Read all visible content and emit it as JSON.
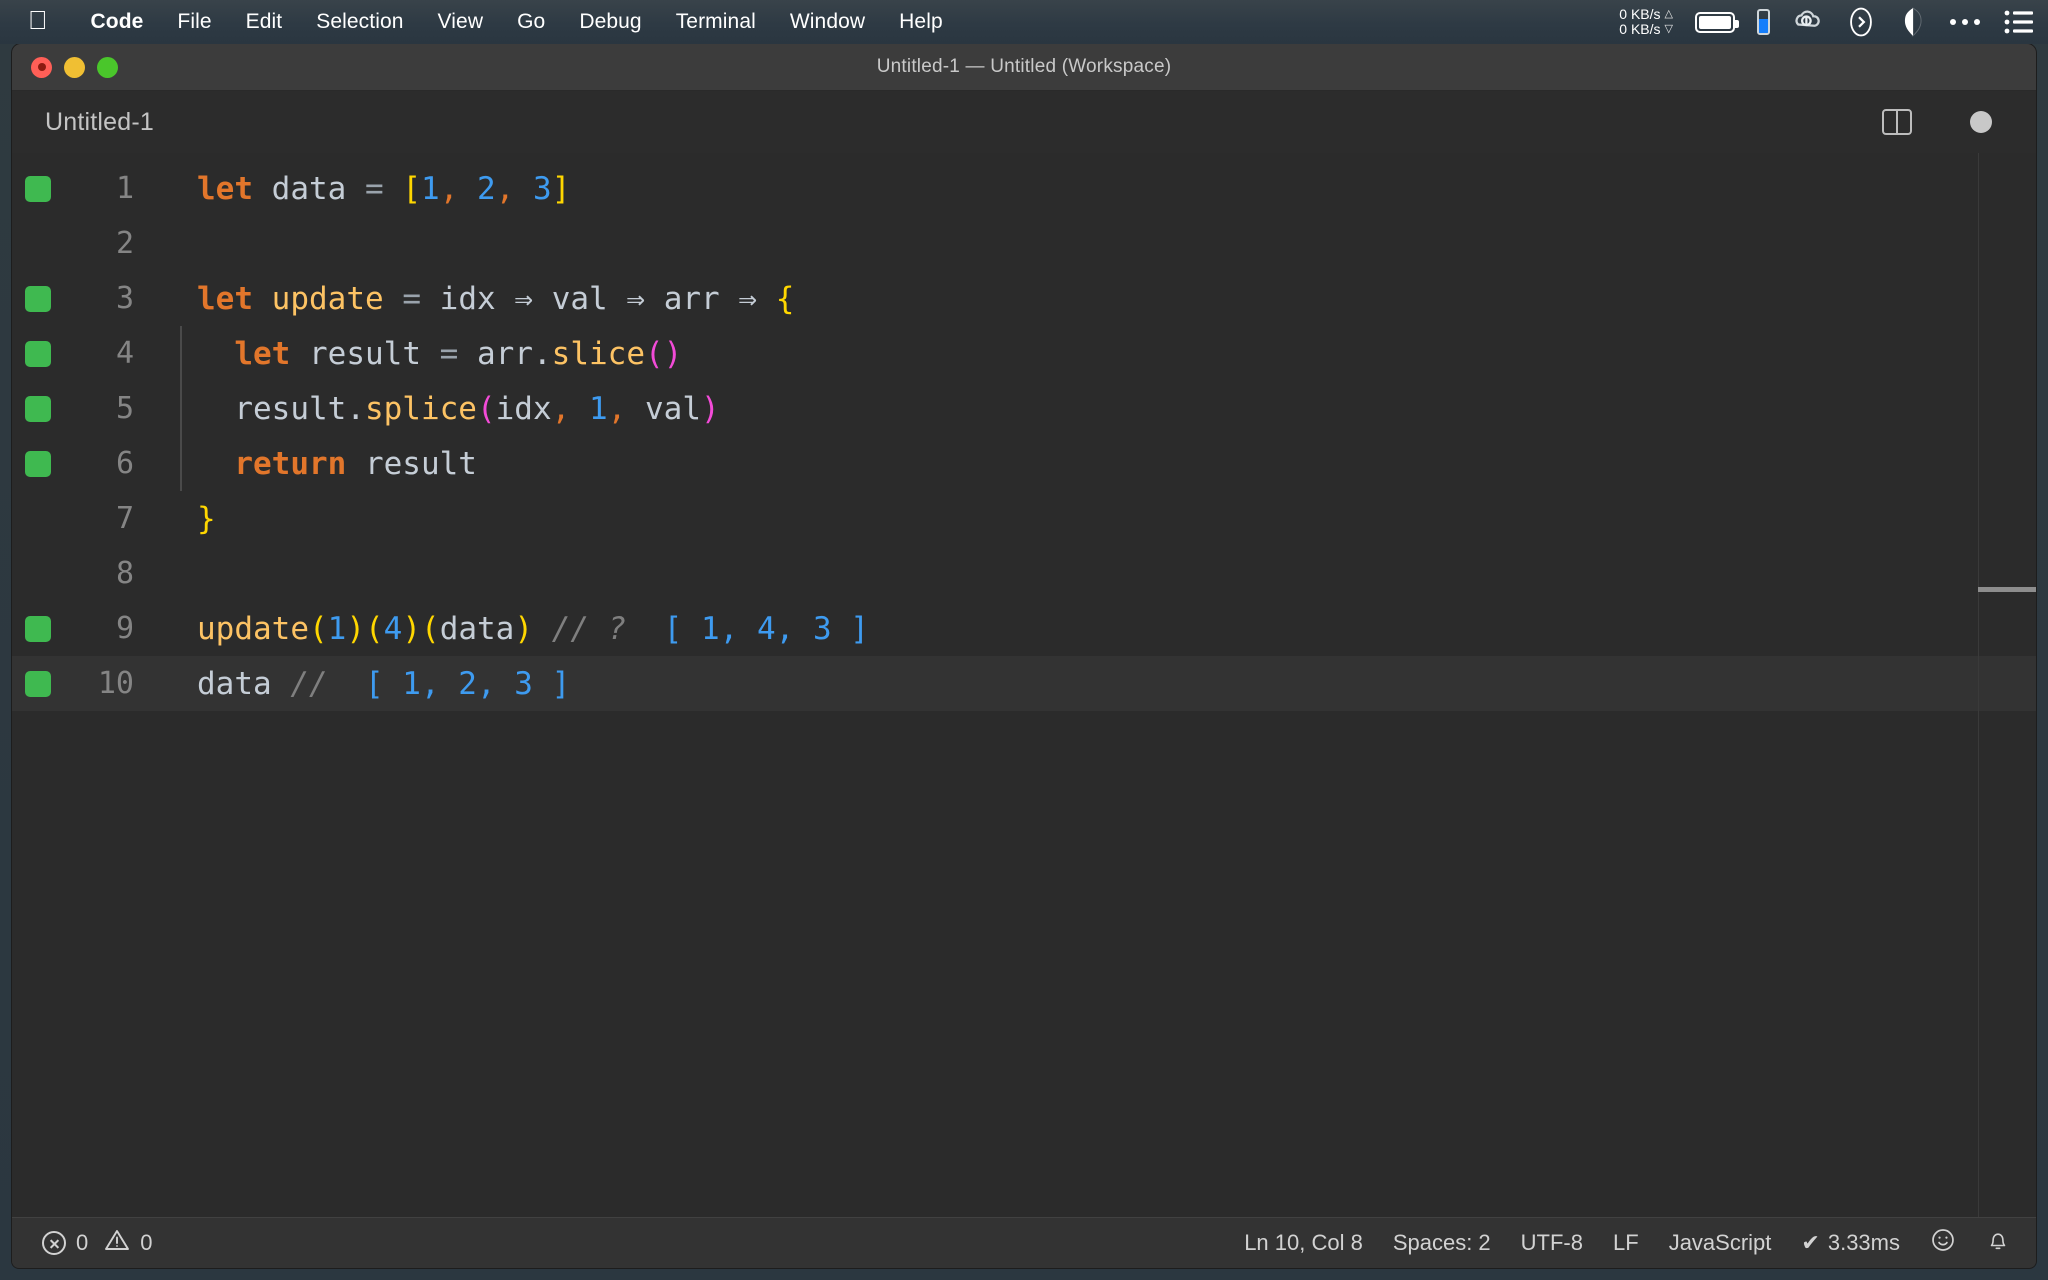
{
  "menubar": {
    "apple_icon": "apple-logo",
    "items": [
      {
        "label": "Code",
        "bold": true
      },
      {
        "label": "File",
        "bold": false
      },
      {
        "label": "Edit",
        "bold": false
      },
      {
        "label": "Selection",
        "bold": false
      },
      {
        "label": "View",
        "bold": false
      },
      {
        "label": "Go",
        "bold": false
      },
      {
        "label": "Debug",
        "bold": false
      },
      {
        "label": "Terminal",
        "bold": false
      },
      {
        "label": "Window",
        "bold": false
      },
      {
        "label": "Help",
        "bold": false
      }
    ],
    "net_up": "0 KB/s",
    "net_down": "0 KB/s",
    "up_arrow": "△",
    "down_arrow": "▽",
    "status_icons": [
      "battery-icon",
      "phone-battery-icon",
      "cloud-sync-icon",
      "chevron-circle-icon",
      "shield-icon",
      "ellipsis-icon",
      "list-menu-icon"
    ]
  },
  "window": {
    "title": "Untitled-1 — Untitled (Workspace)",
    "traffic_lights": [
      "close",
      "minimize",
      "zoom"
    ]
  },
  "tabbar": {
    "tabs": [
      {
        "label": "Untitled-1",
        "active": true,
        "dirty": true
      }
    ],
    "split_editor_icon": "split-editor-icon",
    "unsaved_indicator": "unsaved-dot-icon"
  },
  "editor": {
    "language": "JavaScript",
    "current_line": 10,
    "lines": [
      {
        "number": "1",
        "marker": "green",
        "current": false,
        "indent_guide": false,
        "tokens": [
          {
            "t": "let",
            "c": "t-key"
          },
          {
            "t": " ",
            "c": "t-plain"
          },
          {
            "t": "data",
            "c": "t-plain"
          },
          {
            "t": " ",
            "c": "t-plain"
          },
          {
            "t": "=",
            "c": "t-op"
          },
          {
            "t": " ",
            "c": "t-plain"
          },
          {
            "t": "[",
            "c": "t-br1"
          },
          {
            "t": "1",
            "c": "t-num"
          },
          {
            "t": ",",
            "c": "t-comma"
          },
          {
            "t": " ",
            "c": "t-plain"
          },
          {
            "t": "2",
            "c": "t-num"
          },
          {
            "t": ",",
            "c": "t-comma"
          },
          {
            "t": " ",
            "c": "t-plain"
          },
          {
            "t": "3",
            "c": "t-num"
          },
          {
            "t": "]",
            "c": "t-br1"
          }
        ]
      },
      {
        "number": "2",
        "marker": "none",
        "current": false,
        "indent_guide": false,
        "tokens": []
      },
      {
        "number": "3",
        "marker": "green",
        "current": false,
        "indent_guide": false,
        "tokens": [
          {
            "t": "let",
            "c": "t-key"
          },
          {
            "t": " ",
            "c": "t-plain"
          },
          {
            "t": "update",
            "c": "t-fn"
          },
          {
            "t": " ",
            "c": "t-plain"
          },
          {
            "t": "=",
            "c": "t-op"
          },
          {
            "t": " ",
            "c": "t-plain"
          },
          {
            "t": "idx",
            "c": "t-plain"
          },
          {
            "t": " ",
            "c": "t-plain"
          },
          {
            "t": "⇒",
            "c": "t-arrow"
          },
          {
            "t": " ",
            "c": "t-plain"
          },
          {
            "t": "val",
            "c": "t-plain"
          },
          {
            "t": " ",
            "c": "t-plain"
          },
          {
            "t": "⇒",
            "c": "t-arrow"
          },
          {
            "t": " ",
            "c": "t-plain"
          },
          {
            "t": "arr",
            "c": "t-plain"
          },
          {
            "t": " ",
            "c": "t-plain"
          },
          {
            "t": "⇒",
            "c": "t-arrow"
          },
          {
            "t": " ",
            "c": "t-plain"
          },
          {
            "t": "{",
            "c": "t-br1"
          }
        ]
      },
      {
        "number": "4",
        "marker": "green",
        "current": false,
        "indent_guide": true,
        "tokens": [
          {
            "t": "  ",
            "c": "t-plain"
          },
          {
            "t": "let",
            "c": "t-key"
          },
          {
            "t": " ",
            "c": "t-plain"
          },
          {
            "t": "result",
            "c": "t-plain"
          },
          {
            "t": " ",
            "c": "t-plain"
          },
          {
            "t": "=",
            "c": "t-op"
          },
          {
            "t": " ",
            "c": "t-plain"
          },
          {
            "t": "arr",
            "c": "t-plain"
          },
          {
            "t": ".",
            "c": "t-plain"
          },
          {
            "t": "slice",
            "c": "t-fn"
          },
          {
            "t": "(",
            "c": "t-br2"
          },
          {
            "t": ")",
            "c": "t-br2"
          }
        ]
      },
      {
        "number": "5",
        "marker": "green",
        "current": false,
        "indent_guide": true,
        "tokens": [
          {
            "t": "  ",
            "c": "t-plain"
          },
          {
            "t": "result",
            "c": "t-plain"
          },
          {
            "t": ".",
            "c": "t-plain"
          },
          {
            "t": "splice",
            "c": "t-fn"
          },
          {
            "t": "(",
            "c": "t-br2"
          },
          {
            "t": "idx",
            "c": "t-plain"
          },
          {
            "t": ",",
            "c": "t-comma"
          },
          {
            "t": " ",
            "c": "t-plain"
          },
          {
            "t": "1",
            "c": "t-num"
          },
          {
            "t": ",",
            "c": "t-comma"
          },
          {
            "t": " ",
            "c": "t-plain"
          },
          {
            "t": "val",
            "c": "t-plain"
          },
          {
            "t": ")",
            "c": "t-br2"
          }
        ]
      },
      {
        "number": "6",
        "marker": "green",
        "current": false,
        "indent_guide": true,
        "tokens": [
          {
            "t": "  ",
            "c": "t-plain"
          },
          {
            "t": "return",
            "c": "t-key"
          },
          {
            "t": " ",
            "c": "t-plain"
          },
          {
            "t": "result",
            "c": "t-plain"
          }
        ]
      },
      {
        "number": "7",
        "marker": "none",
        "current": false,
        "indent_guide": false,
        "tokens": [
          {
            "t": "}",
            "c": "t-br1"
          }
        ]
      },
      {
        "number": "8",
        "marker": "none",
        "current": false,
        "indent_guide": false,
        "tokens": []
      },
      {
        "number": "9",
        "marker": "green",
        "current": false,
        "indent_guide": false,
        "tokens": [
          {
            "t": "update",
            "c": "t-fn"
          },
          {
            "t": "(",
            "c": "t-br1"
          },
          {
            "t": "1",
            "c": "t-num"
          },
          {
            "t": ")",
            "c": "t-br1"
          },
          {
            "t": "(",
            "c": "t-br1"
          },
          {
            "t": "4",
            "c": "t-num"
          },
          {
            "t": ")",
            "c": "t-br1"
          },
          {
            "t": "(",
            "c": "t-br1"
          },
          {
            "t": "data",
            "c": "t-plain"
          },
          {
            "t": ")",
            "c": "t-br1"
          },
          {
            "t": " ",
            "c": "t-plain"
          },
          {
            "t": "// ?",
            "c": "t-comment"
          },
          {
            "t": "  ",
            "c": "t-plain"
          },
          {
            "t": "[ 1, 4, 3 ]",
            "c": "t-cmt-val"
          }
        ]
      },
      {
        "number": "10",
        "marker": "green",
        "current": true,
        "indent_guide": false,
        "tokens": [
          {
            "t": "data",
            "c": "t-plain"
          },
          {
            "t": " ",
            "c": "t-plain"
          },
          {
            "t": "//",
            "c": "t-comment"
          },
          {
            "t": "  ",
            "c": "t-plain"
          },
          {
            "t": "[ 1, 2, 3 ]",
            "c": "t-cmt-val"
          }
        ]
      }
    ]
  },
  "statusbar": {
    "error_icon": "error-circle-icon",
    "error_count": "0",
    "warning_icon": "warning-triangle-icon",
    "warning_count": "0",
    "cursor_position": "Ln 10, Col 8",
    "indentation": "Spaces: 2",
    "encoding": "UTF-8",
    "eol": "LF",
    "language_mode": "JavaScript",
    "quokka_check": "✔",
    "quokka_time": "3.33ms",
    "feedback_icon": "smiley-icon",
    "notifications_icon": "bell-icon"
  },
  "colors": {
    "keyword": "#e2762b",
    "function": "#fdc364",
    "number": "#3e9bf0",
    "bracket_yellow": "#ffd700",
    "bracket_magenta": "#f34bd8",
    "comment": "#7f7f7f",
    "plain": "#c5cdd6",
    "editor_bg": "#2b2b2b",
    "gutter_marker_green": "#3fb950",
    "accent_blue": "#157efb"
  }
}
